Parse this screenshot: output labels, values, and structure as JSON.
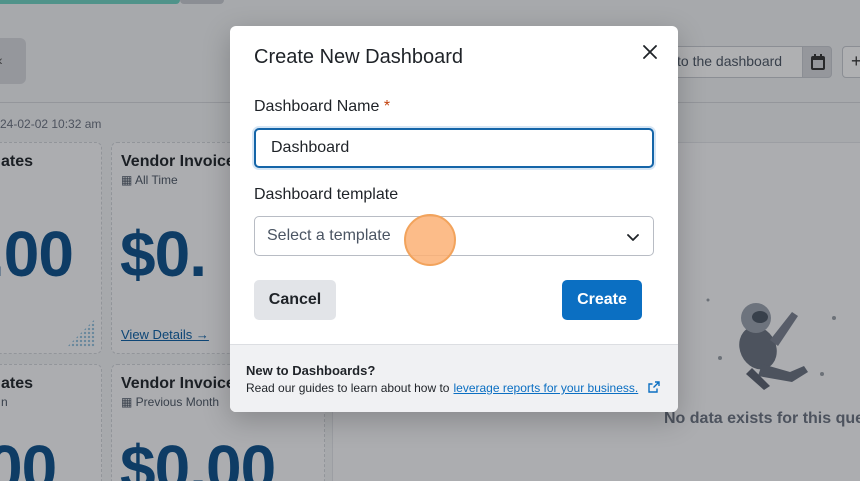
{
  "background": {
    "timestamp": "24-02-02 10:32 am",
    "search_text": "to the dashboard",
    "cards": [
      {
        "title": "ates",
        "subtitle": "",
        "value": ".00",
        "link": ""
      },
      {
        "title": "Vendor Invoice",
        "subtitle": "All Time",
        "value": "$0.",
        "link": "View Details →"
      },
      {
        "title": "ates",
        "subtitle": "n",
        "value": "00",
        "link": ""
      },
      {
        "title": "Vendor Invoice",
        "subtitle": "Previous Month",
        "value": "$0.00",
        "link": ""
      }
    ],
    "no_data": "No data exists for this quer"
  },
  "modal": {
    "title": "Create New Dashboard",
    "name_label": "Dashboard Name",
    "required_mark": "*",
    "name_value": "Dashboard",
    "template_label": "Dashboard template",
    "template_placeholder": "Select a template",
    "cancel_label": "Cancel",
    "create_label": "Create",
    "footer_title": "New to Dashboards?",
    "footer_text": "Read our guides to learn about how to",
    "footer_link": "leverage reports for your business."
  },
  "colors": {
    "primary": "#0b6fc2",
    "value_blue": "#0b4f8a",
    "required": "#c2410c"
  },
  "icons": [
    "close-icon",
    "chevron-down-icon",
    "external-link-icon",
    "calendar-icon",
    "plus-icon"
  ]
}
